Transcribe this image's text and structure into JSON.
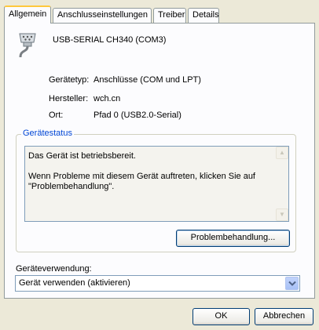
{
  "tabs": [
    {
      "label": "Allgemein",
      "active": true
    },
    {
      "label": "Anschlusseinstellungen",
      "active": false
    },
    {
      "label": "Treiber",
      "active": false
    },
    {
      "label": "Details",
      "active": false
    }
  ],
  "device": {
    "icon": "serial-port-icon",
    "name": "USB-SERIAL CH340 (COM3)"
  },
  "properties": [
    {
      "label": "Gerätetyp:",
      "value": "Anschlüsse (COM und LPT)"
    },
    {
      "label": "Hersteller:",
      "value": "wch.cn"
    },
    {
      "label": "Ort:",
      "value": "Pfad 0 (USB2.0-Serial)"
    }
  ],
  "status_group": {
    "title": "Gerätestatus",
    "text": "Das Gerät ist betriebsbereit.\n\nWenn Probleme mit diesem Gerät auftreten, klicken Sie auf\n\"Problembehandlung\".",
    "troubleshoot_label": "Problembehandlung..."
  },
  "usage": {
    "label": "Geräteverwendung:",
    "selected": "Gerät verwenden (aktivieren)"
  },
  "buttons": {
    "ok": "OK",
    "cancel": "Abbrechen"
  },
  "colors": {
    "accent_tab": "#ffc83c",
    "group_title": "#0046d5",
    "dialog_bg": "#ece9d8"
  }
}
